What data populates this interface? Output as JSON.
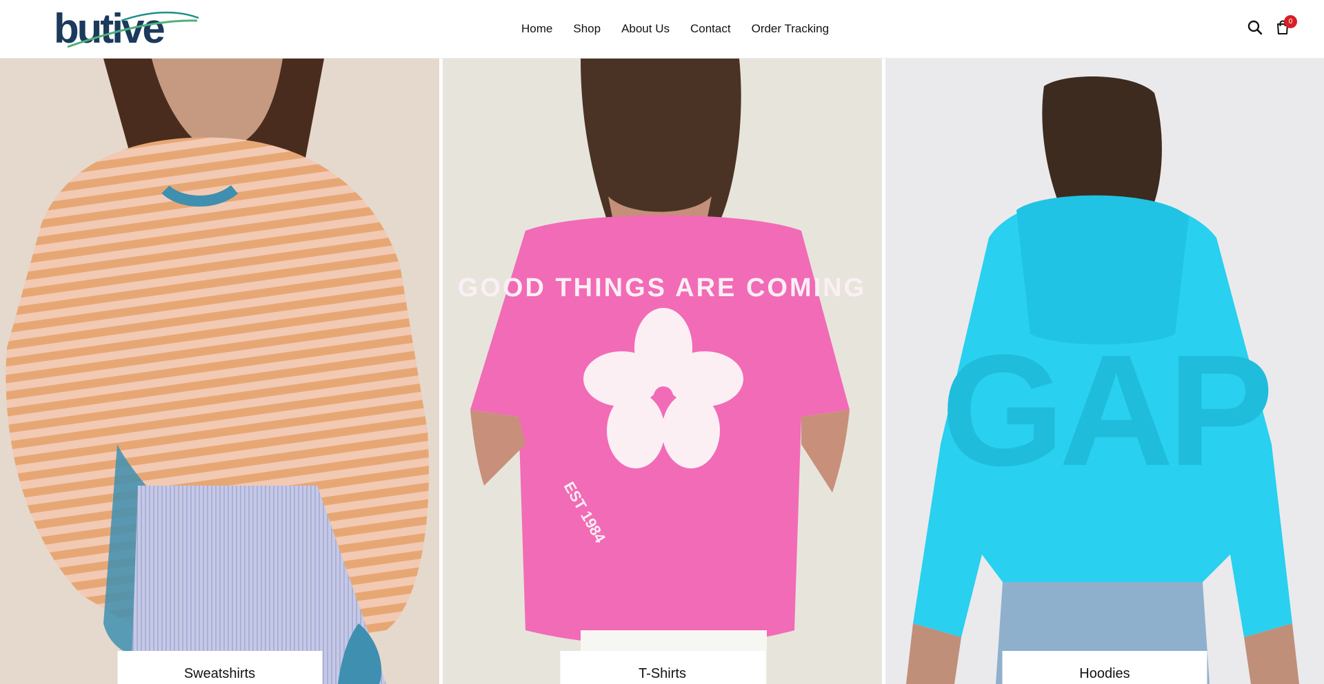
{
  "brand": {
    "logo_text": "butive",
    "colors": {
      "navy": "#1b3a5c",
      "teal": "#1f8e87",
      "green": "#4fb07a"
    }
  },
  "nav": {
    "items": [
      {
        "label": "Home"
      },
      {
        "label": "Shop"
      },
      {
        "label": "About Us"
      },
      {
        "label": "Contact"
      },
      {
        "label": "Order Tracking"
      }
    ]
  },
  "header_icons": {
    "search": "search-icon",
    "cart": "cart-icon",
    "cart_count": "0",
    "badge_color": "#d61f26"
  },
  "categories": [
    {
      "label": "Sweatshirts",
      "image": "striped-orange-sweatshirt"
    },
    {
      "label": "T-Shirts",
      "image": "pink-good-things-tshirt",
      "print_text": "GOOD THINGS ARE COMING",
      "print_est": "EST 1984"
    },
    {
      "label": "Hoodies",
      "image": "cyan-hoodie",
      "print_text": "GAP"
    }
  ]
}
